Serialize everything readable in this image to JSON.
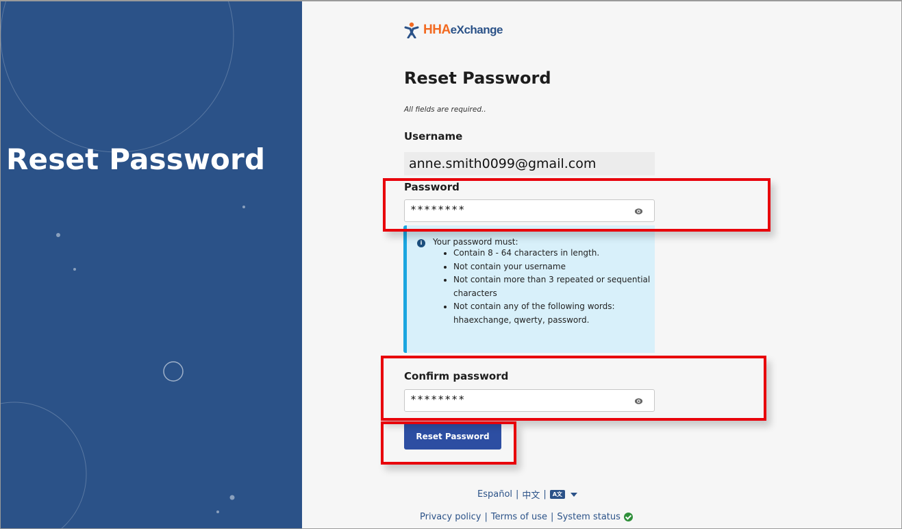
{
  "brand": {
    "name_prefix": "HHA",
    "name_suffix": "eXchange",
    "colors": {
      "orange": "#f26a21",
      "navy": "#2b5288",
      "button": "#2d4ea2",
      "info_border": "#1aa6e0",
      "highlight": "#e8000b"
    }
  },
  "left_panel": {
    "title": "Reset Password"
  },
  "form": {
    "title": "Reset Password",
    "required_note": "All fields are required..",
    "username": {
      "label": "Username",
      "value": "anne.smith0099@gmail.com"
    },
    "password": {
      "label": "Password",
      "value": "********",
      "toggle_icon": "eye-icon"
    },
    "rules": {
      "heading": "Your password must:",
      "items": [
        "Contain 8 - 64 characters in length.",
        "Not contain your username",
        "Not contain more than 3 repeated or sequential characters",
        "Not contain any of the following words: hhaexchange, qwerty, password."
      ]
    },
    "confirm_password": {
      "label": "Confirm password",
      "value": "********",
      "toggle_icon": "eye-icon"
    },
    "submit_label": "Reset Password"
  },
  "language": {
    "spanish": "Español",
    "chinese": "中文",
    "separator": "|",
    "translate_icon": "translate-icon"
  },
  "footer": {
    "privacy": "Privacy policy",
    "terms": "Terms of use",
    "status": "System status",
    "separator": "|"
  }
}
